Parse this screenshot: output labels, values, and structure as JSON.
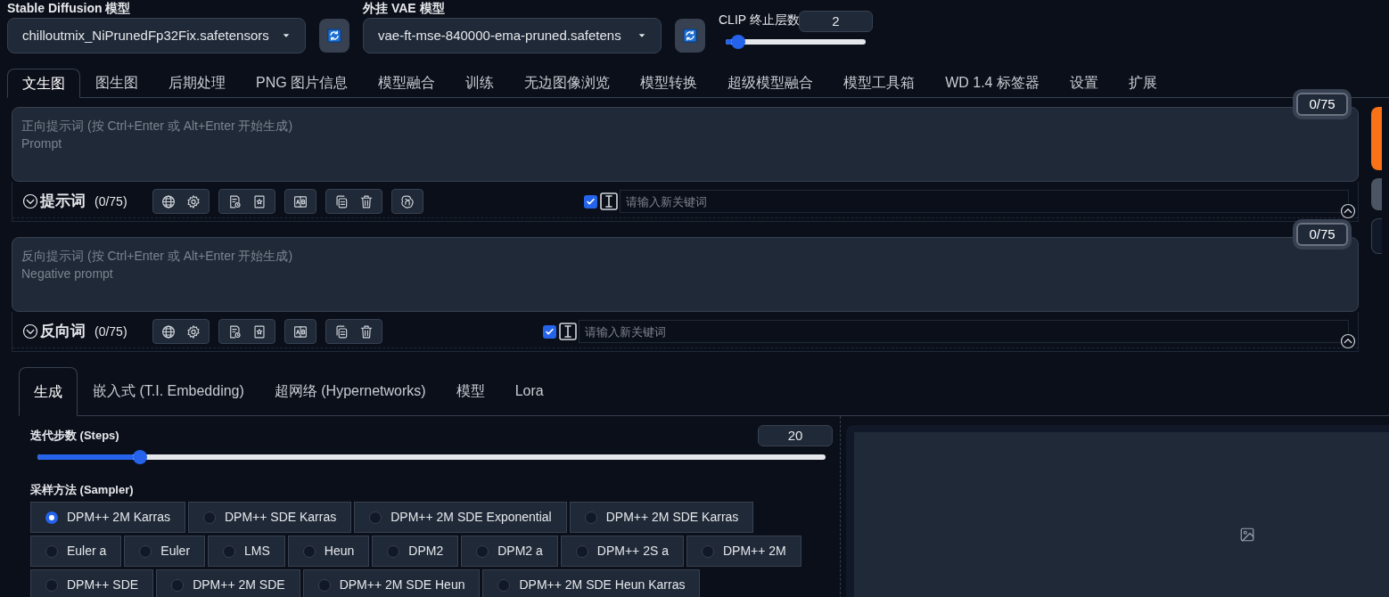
{
  "models": [
    {
      "label": "Stable Diffusion 模型",
      "value": "chilloutmix_NiPrunedFp32Fix.safetensors"
    },
    {
      "label": "外挂 VAE 模型",
      "value": "vae-ft-mse-840000-ema-pruned.safetens"
    }
  ],
  "clip": {
    "label": "CLIP 终止层数",
    "value": "2",
    "level": 0.09
  },
  "tabs": [
    {
      "label": "文生图",
      "selected": true
    },
    {
      "label": "图生图",
      "selected": false
    },
    {
      "label": "后期处理",
      "selected": false
    },
    {
      "label": "PNG 图片信息",
      "selected": false
    },
    {
      "label": "模型融合",
      "selected": false
    },
    {
      "label": "训练",
      "selected": false
    },
    {
      "label": "无边图像浏览",
      "selected": false
    },
    {
      "label": "模型转换",
      "selected": false
    },
    {
      "label": "超级模型融合",
      "selected": false
    },
    {
      "label": "模型工具箱",
      "selected": false
    },
    {
      "label": "WD 1.4 标签器",
      "selected": false
    },
    {
      "label": "设置",
      "selected": false
    },
    {
      "label": "扩展",
      "selected": false
    }
  ],
  "prompts": [
    {
      "placeholder": "正向提示词 (按 Ctrl+Enter 或 Alt+Enter 开始生成)\nPrompt",
      "counter": "0/75",
      "title": "提示词",
      "count": "(0/75)",
      "ai_button": true,
      "keyword_enabled": true,
      "keyword_placeholder": "请输入新关键词"
    },
    {
      "placeholder": "反向提示词 (按 Ctrl+Enter 或 Alt+Enter 开始生成)\nNegative prompt",
      "counter": "0/75",
      "title": "反向词",
      "count": "(0/75)",
      "ai_button": false,
      "keyword_enabled": true,
      "keyword_placeholder": "请输入新关键词"
    }
  ],
  "side_buttons": [
    {
      "kind": "primary"
    },
    {
      "kind": "secondary"
    },
    {
      "kind": "plain"
    }
  ],
  "subtabs": [
    {
      "label": "生成",
      "selected": true
    },
    {
      "label": "嵌入式 (T.I. Embedding)",
      "selected": false
    },
    {
      "label": "超网络 (Hypernetworks)",
      "selected": false
    },
    {
      "label": "模型",
      "selected": false
    },
    {
      "label": "Lora",
      "selected": false
    }
  ],
  "steps": {
    "label": "迭代步数 (Steps)",
    "value": "20",
    "level": 0.13
  },
  "sampler": {
    "label": "采样方法 (Sampler)",
    "options": [
      {
        "label": "DPM++ 2M Karras",
        "selected": true
      },
      {
        "label": "DPM++ SDE Karras",
        "selected": false
      },
      {
        "label": "DPM++ 2M SDE Exponential",
        "selected": false
      },
      {
        "label": "DPM++ 2M SDE Karras",
        "selected": false
      },
      {
        "label": "Euler a",
        "selected": false
      },
      {
        "label": "Euler",
        "selected": false
      },
      {
        "label": "LMS",
        "selected": false
      },
      {
        "label": "Heun",
        "selected": false
      },
      {
        "label": "DPM2",
        "selected": false
      },
      {
        "label": "DPM2 a",
        "selected": false
      },
      {
        "label": "DPM++ 2S a",
        "selected": false
      },
      {
        "label": "DPM++ 2M",
        "selected": false
      },
      {
        "label": "DPM++ SDE",
        "selected": false
      },
      {
        "label": "DPM++ 2M SDE",
        "selected": false
      },
      {
        "label": "DPM++ 2M SDE Heun",
        "selected": false
      },
      {
        "label": "DPM++ 2M SDE Heun Karras",
        "selected": false
      }
    ]
  }
}
